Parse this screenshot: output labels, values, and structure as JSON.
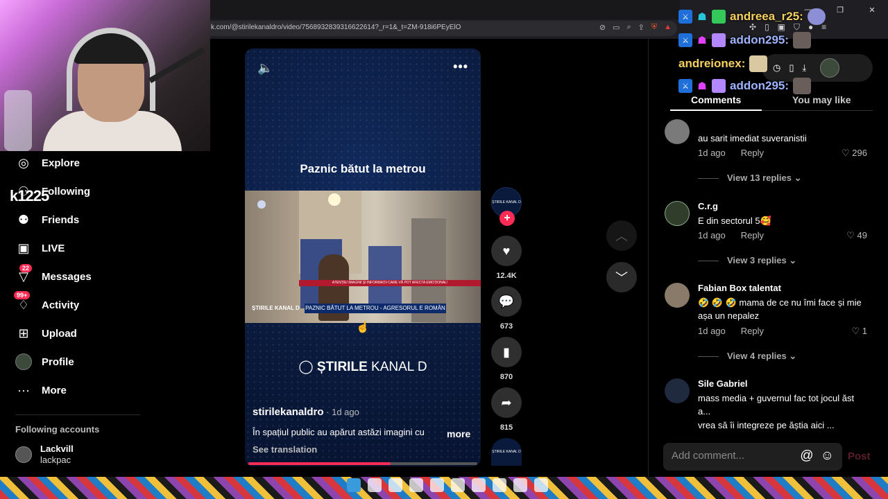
{
  "browser": {
    "url": "k.com/@stirilekanaldro/video/7568932839316622614?_r=1&_t=ZM-918i6PEyElO"
  },
  "nav": {
    "items": [
      {
        "id": "explore",
        "label": "Explore",
        "icon": "compass-icon",
        "badge": ""
      },
      {
        "id": "following",
        "label": "Following",
        "icon": "following-icon",
        "badge": ""
      },
      {
        "id": "friends",
        "label": "Friends",
        "icon": "friends-icon",
        "badge": ""
      },
      {
        "id": "live",
        "label": "LIVE",
        "icon": "live-tv-icon",
        "badge": ""
      },
      {
        "id": "messages",
        "label": "Messages",
        "icon": "paper-plane-icon",
        "badge": "22"
      },
      {
        "id": "activity",
        "label": "Activity",
        "icon": "bell-icon",
        "badge": "99+"
      },
      {
        "id": "upload",
        "label": "Upload",
        "icon": "plus-square-icon",
        "badge": ""
      },
      {
        "id": "profile",
        "label": "Profile",
        "icon": "avatar-icon",
        "badge": ""
      },
      {
        "id": "more",
        "label": "More",
        "icon": "ellipsis-icon",
        "badge": ""
      }
    ],
    "overlay_tag": "k1225",
    "following_accounts_title": "Following accounts",
    "accounts": [
      {
        "name": "Lackvill",
        "handle": "lackpac"
      }
    ]
  },
  "video": {
    "title": "Paznic bătut la metrou",
    "clip_banner_small": "ATENȚIE! IMAGINI ȘI INFORMAȚII CARE VĂ POT AFECTA EMOȚIONAL!",
    "clip_logo": "ȘTIRILE KANAL D",
    "clip_banner": "PAZNIC BĂTUT LA METROU - AGRESORUL E ROMÂN",
    "brand_bold": "ȘTIRILE",
    "brand_light": " KANAL D",
    "author": "stirilekanaldro",
    "date": " · 1d ago",
    "caption": "În spațiul public au apărut astăzi imagini cu",
    "more": "more",
    "see_translation": "See translation",
    "progress": 0.62
  },
  "actions": {
    "avatar_text": "ȘTIRILE KANAL D",
    "likes": "12.4K",
    "comments": "673",
    "saves": "870",
    "shares": "815"
  },
  "tabs": {
    "comments": "Comments",
    "you_may_like": "You may like"
  },
  "comments": [
    {
      "user": "",
      "text": "au sarit imediat suveranistii",
      "time": "1d ago",
      "reply": "Reply",
      "likes": "296",
      "view_replies": "View 13 replies"
    },
    {
      "user": "C.r.g",
      "text": "E din sectorul 5🥰",
      "time": "1d ago",
      "reply": "Reply",
      "likes": "49",
      "view_replies": "View 3 replies"
    },
    {
      "user": "Fabian Box talentat",
      "text": "🤣 🤣 🤣 mama de ce nu îmi face și mie așa un nepalez",
      "time": "1d ago",
      "reply": "Reply",
      "likes": "1",
      "view_replies": "View 4 replies"
    },
    {
      "user": "Sile Gabriel",
      "text": "mass media + guvernul fac tot jocul ăst a...",
      "text2": "vrea să îi integreze pe ăștia aici ..."
    }
  ],
  "comment_box": {
    "placeholder": "Add comment...",
    "post": "Post"
  },
  "chat": [
    {
      "user": "andreea_r25:",
      "color": "gold"
    },
    {
      "user": "addon295:",
      "color": "blue"
    },
    {
      "user": "andreionex:",
      "color": "gold"
    },
    {
      "user": "addon295:",
      "color": "blue"
    }
  ],
  "colors": {
    "accent": "#fe2c55",
    "background": "#000000"
  }
}
